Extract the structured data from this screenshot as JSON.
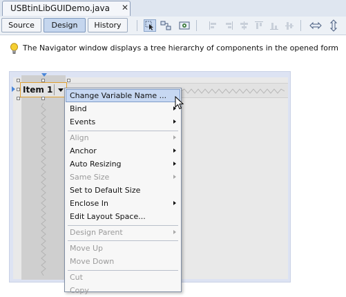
{
  "editor": {
    "file_tab_title": "USBtinLibGUIDemo.java",
    "close_glyph": "✕"
  },
  "view_tabs": {
    "source": "Source",
    "design": "Design",
    "history": "History",
    "active": "Design"
  },
  "toolbar_icons": [
    "selection-mode-icon",
    "connection-mode-icon",
    "preview-design-icon",
    "align-left-icon",
    "align-right-icon",
    "center-horizontally-icon",
    "align-top-icon",
    "align-bottom-icon",
    "center-vertically-icon",
    "change-horizontal-resizability-icon",
    "change-vertical-resizability-icon"
  ],
  "hint": {
    "text": "The Navigator window displays a tree hierarchy of components in the opened form"
  },
  "canvas": {
    "menu_item_label": "Item 1"
  },
  "context_menu": {
    "items": [
      {
        "label": "Change Variable Name ...",
        "enabled": true,
        "submenu": false,
        "highlighted": true
      },
      {
        "label": "Bind",
        "enabled": true,
        "submenu": true
      },
      {
        "label": "Events",
        "enabled": true,
        "submenu": true
      },
      {
        "label": "Align",
        "enabled": false,
        "submenu": true
      },
      {
        "label": "Anchor",
        "enabled": true,
        "submenu": true
      },
      {
        "label": "Auto Resizing",
        "enabled": true,
        "submenu": true
      },
      {
        "label": "Same Size",
        "enabled": false,
        "submenu": true
      },
      {
        "label": "Set to Default Size",
        "enabled": true,
        "submenu": false
      },
      {
        "label": "Enclose In",
        "enabled": true,
        "submenu": true
      },
      {
        "label": "Edit Layout Space...",
        "enabled": true,
        "submenu": false
      },
      {
        "label": "Design Parent",
        "enabled": false,
        "submenu": true
      },
      {
        "label": "Move Up",
        "enabled": false,
        "submenu": false
      },
      {
        "label": "Move Down",
        "enabled": false,
        "submenu": false
      },
      {
        "label": "Cut",
        "enabled": false,
        "submenu": false
      },
      {
        "label": "Copy",
        "enabled": false,
        "submenu": false
      }
    ]
  },
  "colors": {
    "selection_border": "#e0a030",
    "menu_highlight": "#c7d8f2",
    "anchor_marker": "#4a86d8"
  }
}
